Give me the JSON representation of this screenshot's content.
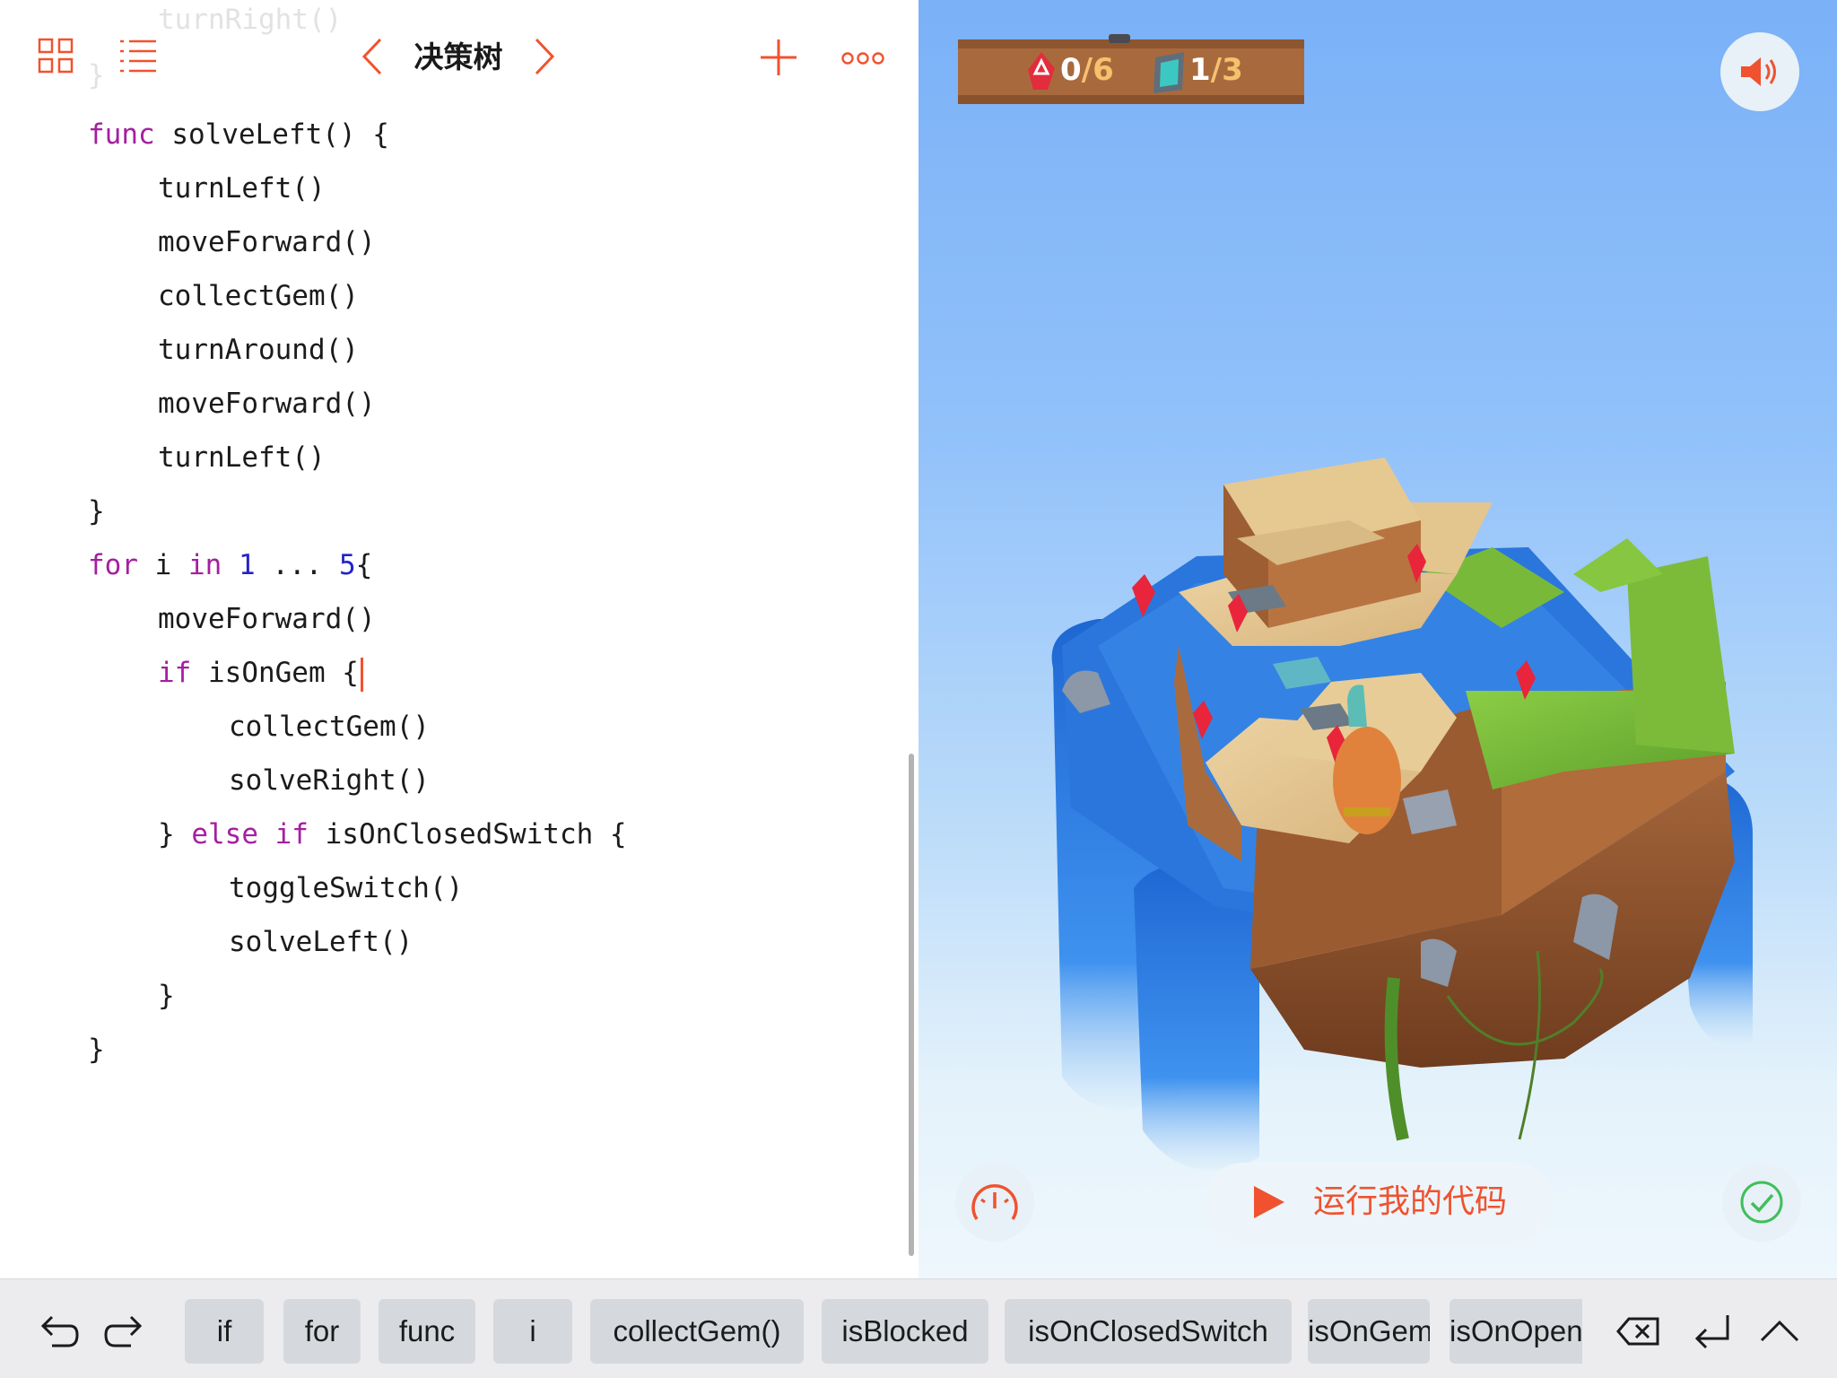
{
  "editor": {
    "ghost_line": "turnRight()",
    "ghost_brace": "}",
    "title": "决策树",
    "code_lines": [
      [
        {
          "t": "func",
          "c": "kw"
        },
        {
          "t": " solveLeft() {",
          "c": "plain"
        }
      ],
      [
        {
          "t": "turnLeft()",
          "c": "plain"
        }
      ],
      [
        {
          "t": "moveForward()",
          "c": "plain"
        }
      ],
      [
        {
          "t": "collectGem()",
          "c": "plain"
        }
      ],
      [
        {
          "t": "turnAround()",
          "c": "plain"
        }
      ],
      [
        {
          "t": "moveForward()",
          "c": "plain"
        }
      ],
      [
        {
          "t": "turnLeft()",
          "c": "plain"
        }
      ],
      [
        {
          "t": "}",
          "c": "plain"
        }
      ],
      [
        {
          "t": "for",
          "c": "kw"
        },
        {
          "t": " i ",
          "c": "plain"
        },
        {
          "t": "in",
          "c": "kw"
        },
        {
          "t": " ",
          "c": "plain"
        },
        {
          "t": "1",
          "c": "num"
        },
        {
          "t": " ... ",
          "c": "plain"
        },
        {
          "t": "5",
          "c": "num"
        },
        {
          "t": "{",
          "c": "plain"
        }
      ],
      [
        {
          "t": "moveForward()",
          "c": "plain"
        }
      ],
      [
        {
          "t": "if",
          "c": "kw"
        },
        {
          "t": " isOnGem {",
          "c": "plain"
        }
      ],
      [
        {
          "t": "collectGem()",
          "c": "plain"
        }
      ],
      [
        {
          "t": "solveRight()",
          "c": "plain"
        }
      ],
      [
        {
          "t": "} ",
          "c": "plain"
        },
        {
          "t": "else if",
          "c": "kw"
        },
        {
          "t": " isOnClosedSwitch {",
          "c": "plain"
        }
      ],
      [
        {
          "t": "toggleSwitch()",
          "c": "plain"
        }
      ],
      [
        {
          "t": "solveLeft()",
          "c": "plain"
        }
      ],
      [
        {
          "t": "}",
          "c": "plain"
        }
      ],
      [
        {
          "t": "}",
          "c": "plain"
        }
      ]
    ]
  },
  "live_view": {
    "gems_collected": "0",
    "gems_total": "/6",
    "switches_on": "1",
    "switches_total": "/3",
    "run_label": "运行我的代码"
  },
  "shortcut_bar": {
    "chips": [
      "if",
      "for",
      "func",
      "i",
      "collectGem()",
      "isBlocked",
      "isOnClosedSwitch",
      "isOnGem",
      "isOnOpenSwitch"
    ]
  },
  "colors": {
    "accent": "#f0522f",
    "keyword": "#a51fa0",
    "number": "#2323c8",
    "sky_top": "#7ab1f7",
    "sky_bottom": "#eef7fc",
    "chip_bg": "#d5d9de",
    "bar_bg": "#ececef",
    "goal_green": "#3fbf5a"
  },
  "icons": {
    "grid": "grid-icon",
    "list": "list-icon",
    "prev": "chevron-left-icon",
    "next": "chevron-right-icon",
    "add": "plus-icon",
    "more": "more-icon",
    "sound": "speaker-icon",
    "speed": "speedometer-icon",
    "play": "play-icon",
    "goal": "checkmark-icon",
    "undo": "undo-icon",
    "redo": "redo-icon",
    "delete": "delete-icon",
    "return": "return-icon",
    "collapse": "chevron-up-icon"
  }
}
